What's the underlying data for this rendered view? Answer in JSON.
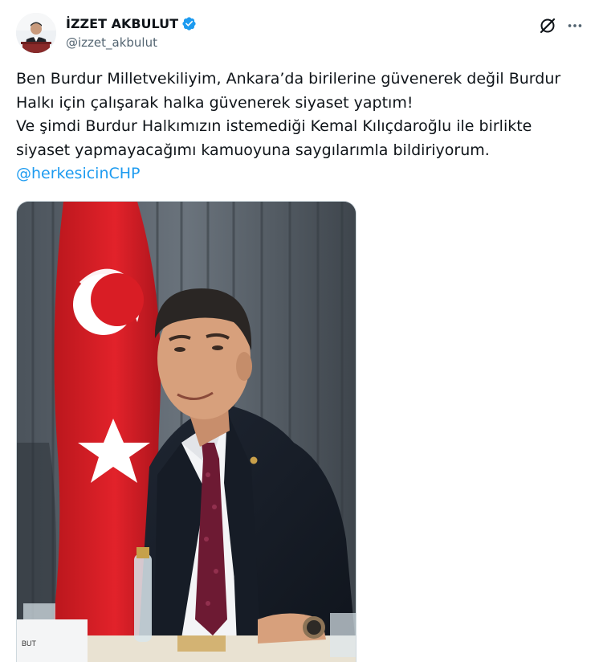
{
  "author": {
    "display_name": "İZZET AKBULUT",
    "handle": "@izzet_akbulut",
    "verified": true,
    "verified_color": "#1d9bf0"
  },
  "icons": {
    "verified": "verified-badge-icon",
    "grok": "grok-icon",
    "more": "more-options-icon"
  },
  "tweet": {
    "lines": [
      "Ben Burdur Milletvekiliyim, Ankara’da birilerine güvenerek değil Burdur",
      "Halkı için çalışarak halka güvenerek siyaset yaptım!",
      "Ve şimdi Burdur Halkımızın istemediği Kemal Kılıçdaroğlu ile birlikte",
      "siyaset yapmayacağımı kamuoyuna saygılarımla bildiriyorum."
    ],
    "mention": "@herkesicinCHP",
    "mention_color": "#1d9bf0"
  },
  "photo": {
    "nameplate_text": "BUT"
  }
}
